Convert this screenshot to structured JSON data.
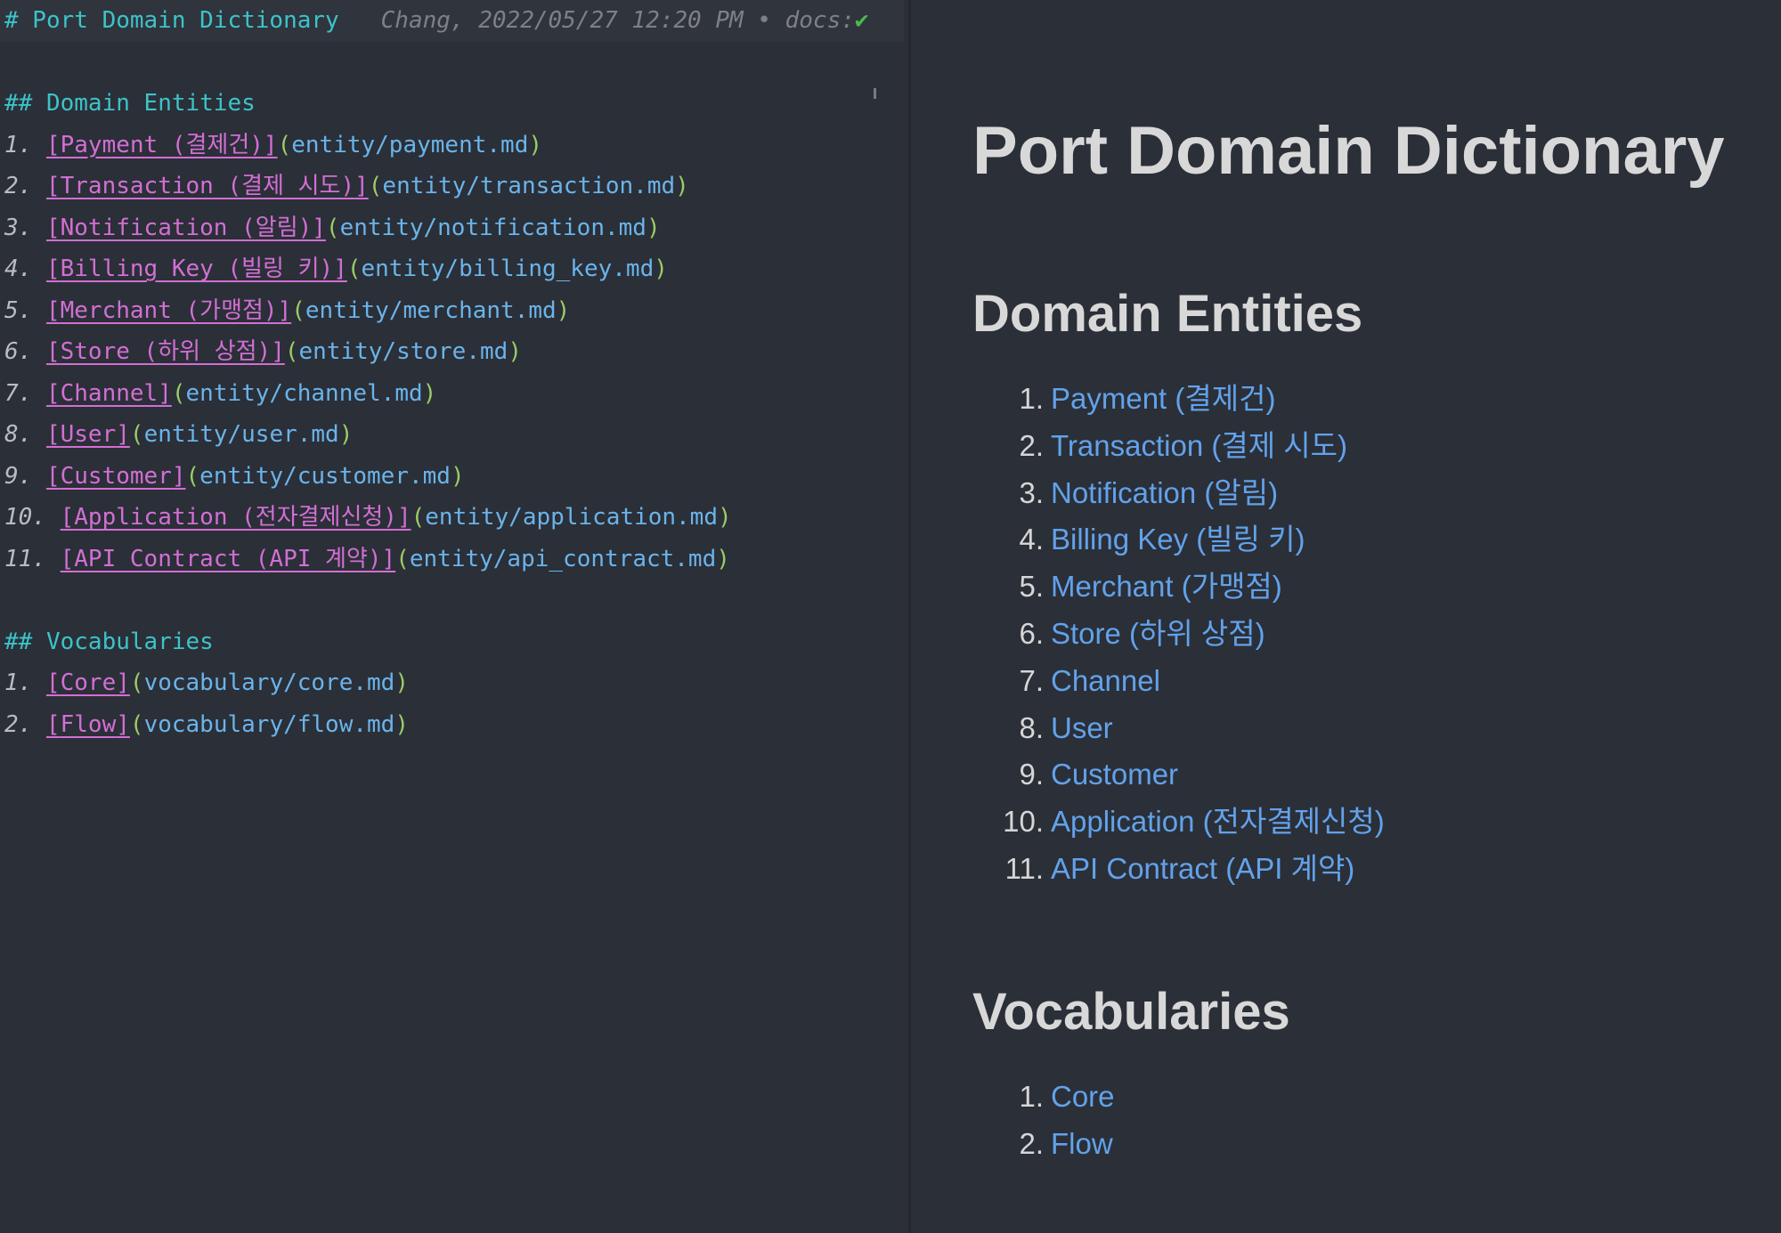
{
  "editor": {
    "title_line": "# Port Domain Dictionary",
    "git_blame": "Chang, 2022/05/27 12:20 PM • docs:",
    "check_icon": "✔",
    "sections": [
      {
        "heading_marker": "##",
        "heading": "Domain Entities",
        "items": [
          {
            "num": "1.",
            "label": "Payment (결제건)",
            "path": "entity/payment.md"
          },
          {
            "num": "2.",
            "label": "Transaction (결제 시도)",
            "path": "entity/transaction.md"
          },
          {
            "num": "3.",
            "label": "Notification (알림)",
            "path": "entity/notification.md"
          },
          {
            "num": "4.",
            "label": "Billing Key (빌링 키)",
            "path": "entity/billing_key.md"
          },
          {
            "num": "5.",
            "label": "Merchant (가맹점)",
            "path": "entity/merchant.md"
          },
          {
            "num": "6.",
            "label": "Store (하위 상점)",
            "path": "entity/store.md"
          },
          {
            "num": "7.",
            "label": "Channel",
            "path": "entity/channel.md"
          },
          {
            "num": "8.",
            "label": "User",
            "path": "entity/user.md"
          },
          {
            "num": "9.",
            "label": "Customer",
            "path": "entity/customer.md"
          },
          {
            "num": "10.",
            "label": "Application (전자결제신청)",
            "path": "entity/application.md"
          },
          {
            "num": "11.",
            "label": "API Contract (API 계약)",
            "path": "entity/api_contract.md"
          }
        ]
      },
      {
        "heading_marker": "##",
        "heading": "Vocabularies",
        "items": [
          {
            "num": "1.",
            "label": "Core",
            "path": "vocabulary/core.md"
          },
          {
            "num": "2.",
            "label": "Flow",
            "path": "vocabulary/flow.md"
          }
        ]
      }
    ]
  },
  "preview": {
    "title": "Port Domain Dictionary",
    "sections": [
      {
        "heading": "Domain Entities",
        "items": [
          "Payment (결제건)",
          "Transaction (결제 시도)",
          "Notification (알림)",
          "Billing Key (빌링 키)",
          "Merchant (가맹점)",
          "Store (하위 상점)",
          "Channel",
          "User",
          "Customer",
          "Application (전자결제신청)",
          "API Contract (API 계약)"
        ]
      },
      {
        "heading": "Vocabularies",
        "items": [
          "Core",
          "Flow"
        ]
      }
    ]
  },
  "colors": {
    "background": "#2b2f38",
    "heading_markdown": "#3cc3c9",
    "link_text_markdown": "#d26fd4",
    "link_path_markdown": "#6ab4ea",
    "link_preview": "#62a2ea"
  }
}
